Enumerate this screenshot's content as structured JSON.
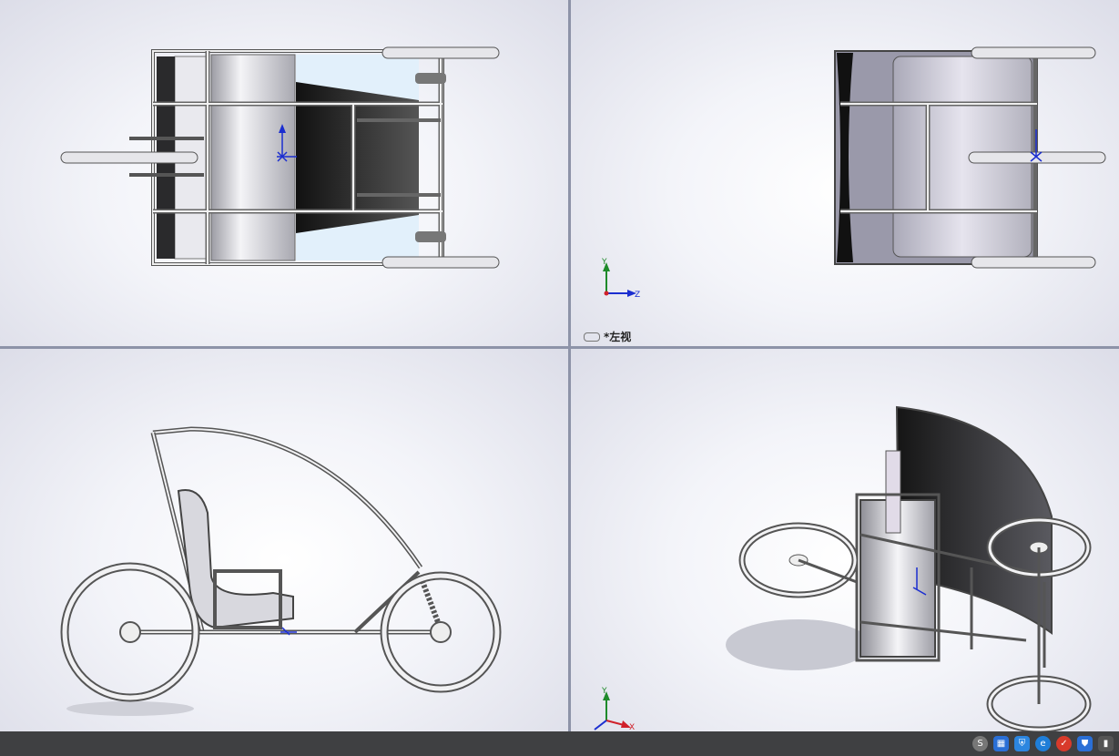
{
  "viewports": {
    "top_left": {
      "view_label": ""
    },
    "top_right": {
      "view_label": "*左视",
      "axes": {
        "y": "Y",
        "z": "Z"
      }
    },
    "bottom_left": {
      "view_label": ""
    },
    "bottom_right": {
      "view_label": "",
      "axes": {
        "y": "Y",
        "x": "X"
      }
    }
  },
  "colors": {
    "viewport_bg": "#eef0f6",
    "frame_tube": "#e8e8ec",
    "panel_dark": "#2b2b2e",
    "axis_x": "#d0202a",
    "axis_y": "#1e8a2a",
    "axis_z": "#1b2ed0",
    "statusbar": "#3f4042"
  },
  "tray_icons": [
    {
      "icon": "s-icon",
      "label": "S"
    },
    {
      "icon": "network-icon",
      "label": ""
    },
    {
      "icon": "shield-icon",
      "label": ""
    },
    {
      "icon": "browser-icon",
      "label": ""
    },
    {
      "icon": "security-check-icon",
      "label": ""
    },
    {
      "icon": "defender-icon",
      "label": ""
    },
    {
      "icon": "usb-icon",
      "label": ""
    }
  ]
}
